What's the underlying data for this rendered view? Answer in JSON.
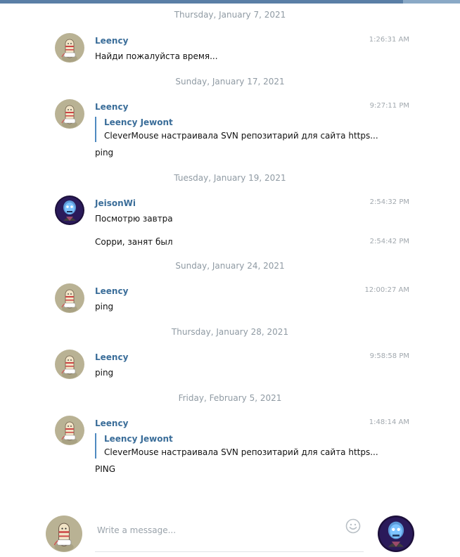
{
  "composer": {
    "placeholder": "Write a message..."
  },
  "days": [
    {
      "date": "Thursday, January 7, 2021",
      "message": {
        "author": "Leency",
        "time": "1:26:31 AM",
        "text": "Найди пожалуйста время..."
      }
    },
    {
      "date": "Sunday, January 17, 2021",
      "message": {
        "author": "Leency",
        "time": "9:27:11 PM",
        "reply": {
          "author": "Leency Jewont",
          "text": "CleverMouse настраивала SVN репозитарий для сайта https..."
        },
        "text": "ping"
      }
    },
    {
      "date": "Tuesday, January 19, 2021",
      "message": {
        "author": "JeisonWi",
        "time": "2:54:32 PM",
        "text": "Посмотрю завтра",
        "followup": {
          "time": "2:54:42 PM",
          "text": "Сорри, занят был"
        }
      }
    },
    {
      "date": "Sunday, January 24, 2021",
      "message": {
        "author": "Leency",
        "time": "12:00:27 AM",
        "text": "ping"
      }
    },
    {
      "date": "Thursday, January 28, 2021",
      "message": {
        "author": "Leency",
        "time": "9:58:58 PM",
        "text": "ping"
      }
    },
    {
      "date": "Friday, February 5, 2021",
      "message": {
        "author": "Leency",
        "time": "1:48:14 AM",
        "reply": {
          "author": "Leency Jewont",
          "text": "CleverMouse настраивала SVN репозитарий для сайта https..."
        },
        "text": "PING"
      }
    }
  ]
}
